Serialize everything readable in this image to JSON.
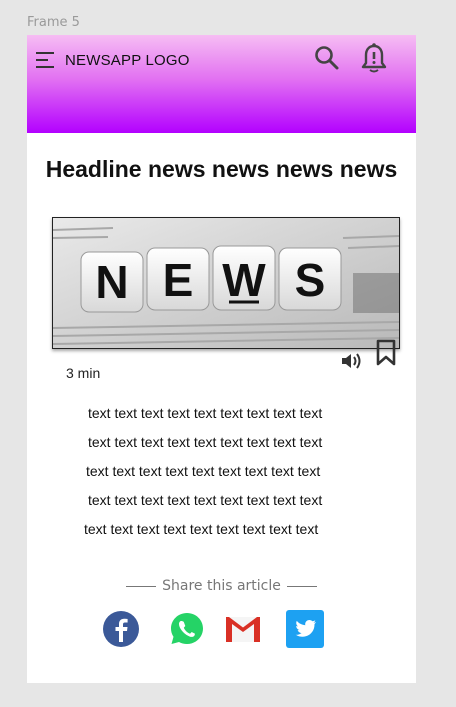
{
  "frame_label": "Frame 5",
  "appbar": {
    "logo_text": "NEWSAPP LOGO",
    "icons": [
      "menu-icon",
      "search-icon",
      "bell-alert-icon"
    ]
  },
  "article": {
    "headline": "Headline news news news news",
    "image_text": "NEWS",
    "read_time": "3 min",
    "actions": [
      "speaker-icon",
      "bookmark-icon"
    ],
    "body_lines": [
      "text text  text  text  text  text  text  text  text",
      "text text  text  text  text  text  text  text  text",
      "text text  text  text  text  text  text  text  text",
      "text text  text  text  text  text  text  text  text",
      "text text  text  text  text  text  text  text  text"
    ]
  },
  "share": {
    "label": "Share this article",
    "networks": [
      "facebook-icon",
      "whatsapp-icon",
      "gmail-icon",
      "twitter-icon"
    ]
  },
  "colors": {
    "appbar_top": "#f6bdf3",
    "appbar_bottom": "#b300ff",
    "facebook": "#3b5998",
    "whatsapp": "#25d366",
    "gmail": "#d93025",
    "twitter": "#1da1f2"
  }
}
